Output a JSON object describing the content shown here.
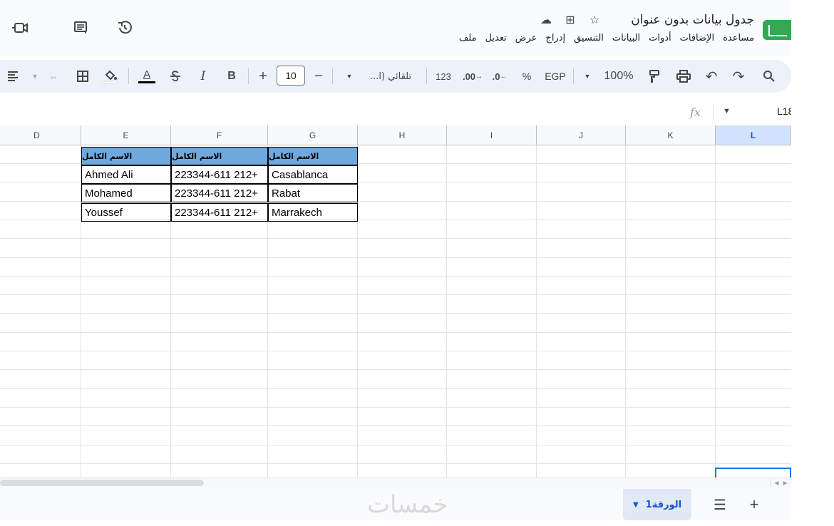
{
  "app": {
    "title": "جدول بيانات بدون عنوان",
    "menus": [
      "ملف",
      "تعديل",
      "عرض",
      "إدراج",
      "التنسيق",
      "البيانات",
      "أدوات",
      "الإضافات",
      "مساعدة"
    ]
  },
  "toolbar": {
    "zoom": "100%",
    "currency": "EGP",
    "percent": "%",
    "dec_decrease": ".0",
    "dec_increase": ".00",
    "number_format": "123",
    "font_name": "تلقائي (ا...",
    "font_size": "10",
    "bold": "B",
    "italic": "I",
    "text_color": "A",
    "plus": "+",
    "minus": "−"
  },
  "formula_bar": {
    "cell_ref": "L18",
    "fx": "fx"
  },
  "grid": {
    "columns": [
      "D",
      "E",
      "F",
      "G",
      "H",
      "I",
      "J",
      "K",
      "L"
    ],
    "selected_column": "L",
    "header_row": [
      "الاسم الكامل",
      "الاسم الكامل",
      "الاسم الكامل"
    ],
    "rows": [
      [
        "Ahmed Ali",
        "223344-611 212+",
        "Casablanca"
      ],
      [
        "Mohamed",
        "223344-611 212+",
        "Rabat"
      ],
      [
        "Youssef",
        "223344-611 212+",
        "Marrakech"
      ]
    ]
  },
  "sheets": {
    "active": "الورقة1"
  },
  "watermark": "خمسات",
  "colors": {
    "header_fill": "#6fa8dc",
    "accent": "#0b57d0",
    "logo": "#34a853"
  }
}
